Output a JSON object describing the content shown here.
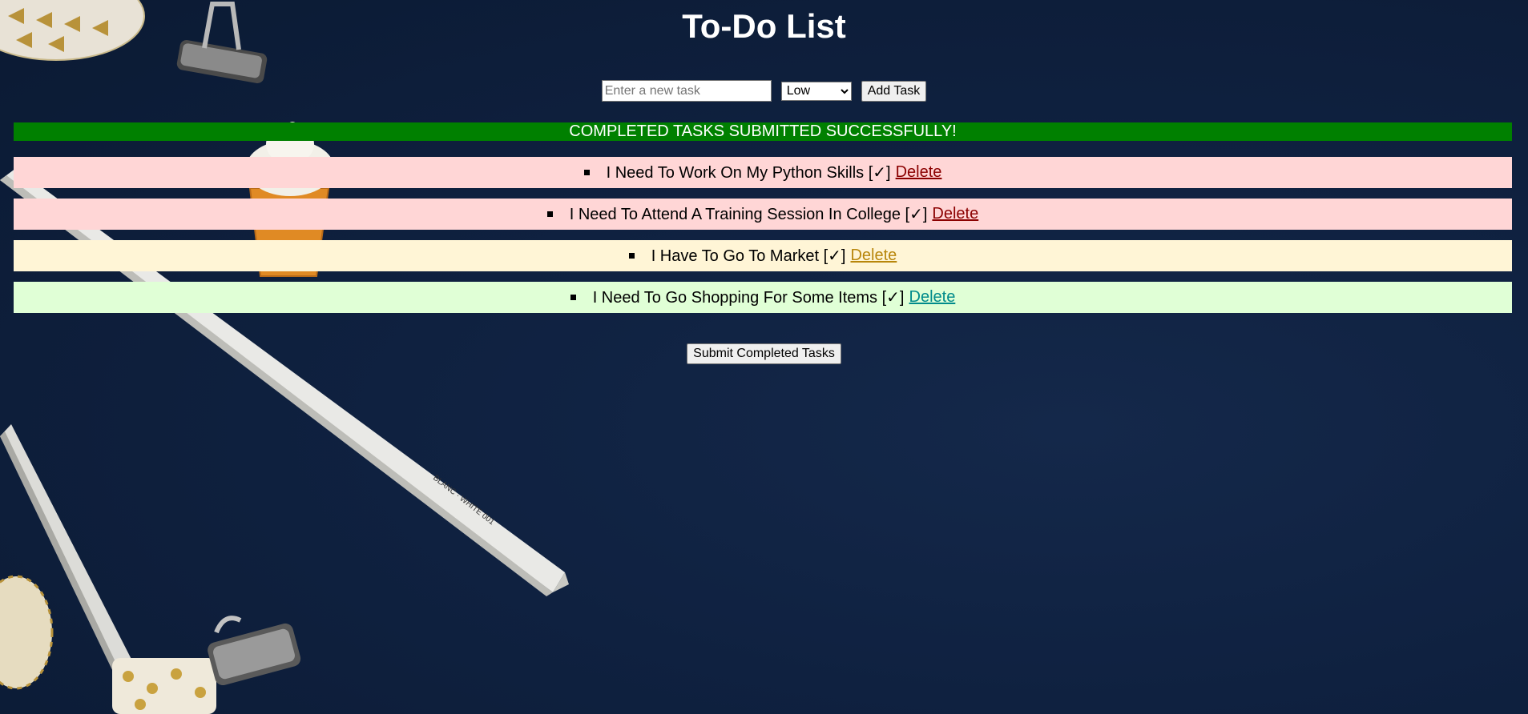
{
  "page": {
    "title": "To-Do List"
  },
  "form": {
    "input_placeholder": "Enter a new task",
    "input_value": "",
    "priority_selected": "Low",
    "priority_options": [
      "Low"
    ],
    "add_button_label": "Add Task"
  },
  "banner": {
    "text": "COMPLETED TASKS SUBMITTED SUCCESSFULLY!",
    "color": "#008000"
  },
  "tasks": [
    {
      "text": "I Need To Work On My Python Skills [✓]",
      "delete_label": "Delete",
      "priority_color": "#ffd6d6",
      "link_color": "#8b0000"
    },
    {
      "text": "I Need To Attend A Training Session In College [✓]",
      "delete_label": "Delete",
      "priority_color": "#ffd6d6",
      "link_color": "#8b0000"
    },
    {
      "text": "I Have To Go To Market [✓]",
      "delete_label": "Delete",
      "priority_color": "#fff5d6",
      "link_color": "#b8860b"
    },
    {
      "text": "I Need To Go Shopping For Some Items [✓]",
      "delete_label": "Delete",
      "priority_color": "#e0ffd6",
      "link_color": "#008b8b"
    }
  ],
  "submit": {
    "label": "Submit Completed Tasks"
  }
}
